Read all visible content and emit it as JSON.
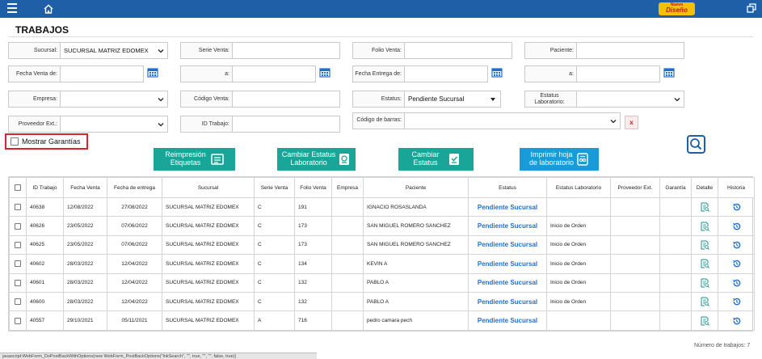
{
  "header": {
    "brand_top": "Nuevo",
    "brand_bottom": "Diseño",
    "accent": "#1f5fa8"
  },
  "page": {
    "title": "TRABAJOS"
  },
  "filters": {
    "sucursal_label": "Sucursal:",
    "sucursal_value": "SUCURSAL MATRIZ EDOMEX",
    "serie_venta_label": "Serie Venta:",
    "folio_venta_label": "Folio Venta:",
    "paciente_label": "Paciente:",
    "fecha_venta_de_label": "Fecha Venta de:",
    "a_label": "a:",
    "fecha_entrega_de_label": "Fecha Entrega de:",
    "empresa_label": "Empresa:",
    "codigo_venta_label": "Código Venta:",
    "estatus_label": "Estatus:",
    "estatus_value": "Pendiente Sucursal",
    "estatus_lab_label_1": "Estatus",
    "estatus_lab_label_2": "Laboratorio:",
    "proveedor_label": "Proveedor Ext.:",
    "id_trabajo_label": "ID Trabajo:",
    "codigo_barras_label": "Código de barras:",
    "clear_label": "x",
    "mostrar_garantias_label": "Mostrar Garantías"
  },
  "actions": {
    "reimpresion_1": "Reimpresión",
    "reimpresion_2": "Etiquetas",
    "cambiar_lab_1": "Cambiar Estatus",
    "cambiar_lab_2": "Laboratorio",
    "cambiar_estatus_1": "Cambiar",
    "cambiar_estatus_2": "Estatus",
    "imprimir_1": "Imprimir hoja",
    "imprimir_2": "de laboratorio"
  },
  "table": {
    "headers": [
      "ID Trabajo",
      "Fecha Venta",
      "Fecha de entrega",
      "Sucursal",
      "Serie Venta",
      "Folio Venta",
      "Empresa",
      "Paciente",
      "Estatus",
      "Estatus Laboratorio",
      "Proveedor Ext.",
      "Garantía",
      "Detalle",
      "Historia"
    ],
    "rows": [
      {
        "id": "40638",
        "fecha_venta": "12/08/2022",
        "fecha_entrega": "27/08/2022",
        "sucursal": "SUCURSAL MATRIZ EDOMEX",
        "serie": "C",
        "folio": "191",
        "empresa": "",
        "paciente": "IGNACIO ROSASLANDA",
        "estatus": "Pendiente Sucursal",
        "estatus_lab": "",
        "proveedor": "",
        "garantia": ""
      },
      {
        "id": "40626",
        "fecha_venta": "23/05/2022",
        "fecha_entrega": "07/06/2022",
        "sucursal": "SUCURSAL MATRIZ EDOMEX",
        "serie": "C",
        "folio": "173",
        "empresa": "",
        "paciente": "SAN MIGUEL ROMERO SANCHEZ",
        "estatus": "Pendiente Sucursal",
        "estatus_lab": "Inicio de Orden",
        "proveedor": "",
        "garantia": ""
      },
      {
        "id": "40625",
        "fecha_venta": "23/05/2022",
        "fecha_entrega": "07/06/2022",
        "sucursal": "SUCURSAL MATRIZ EDOMEX",
        "serie": "C",
        "folio": "173",
        "empresa": "",
        "paciente": "SAN MIGUEL ROMERO SANCHEZ",
        "estatus": "Pendiente Sucursal",
        "estatus_lab": "Inicio de Orden",
        "proveedor": "",
        "garantia": ""
      },
      {
        "id": "40602",
        "fecha_venta": "28/03/2022",
        "fecha_entrega": "12/04/2022",
        "sucursal": "SUCURSAL MATRIZ EDOMEX",
        "serie": "C",
        "folio": "134",
        "empresa": "",
        "paciente": "KEVIN A",
        "estatus": "Pendiente Sucursal",
        "estatus_lab": "Inicio de Orden",
        "proveedor": "",
        "garantia": ""
      },
      {
        "id": "40601",
        "fecha_venta": "28/03/2022",
        "fecha_entrega": "12/04/2022",
        "sucursal": "SUCURSAL MATRIZ EDOMEX",
        "serie": "C",
        "folio": "132",
        "empresa": "",
        "paciente": "PABLO A",
        "estatus": "Pendiente Sucursal",
        "estatus_lab": "Inicio de Orden",
        "proveedor": "",
        "garantia": ""
      },
      {
        "id": "40600",
        "fecha_venta": "28/03/2022",
        "fecha_entrega": "12/04/2022",
        "sucursal": "SUCURSAL MATRIZ EDOMEX",
        "serie": "C",
        "folio": "132",
        "empresa": "",
        "paciente": "PABLO A",
        "estatus": "Pendiente Sucursal",
        "estatus_lab": "Inicio de Orden",
        "proveedor": "",
        "garantia": ""
      },
      {
        "id": "40557",
        "fecha_venta": "29/10/2021",
        "fecha_entrega": "05/11/2021",
        "sucursal": "SUCURSAL MATRIZ EDOMEX",
        "serie": "A",
        "folio": "716",
        "empresa": "",
        "paciente": "pedro camara pech",
        "estatus": "Pendiente Sucursal",
        "estatus_lab": "",
        "proveedor": "",
        "garantia": ""
      }
    ]
  },
  "footer": {
    "count_label": "Número de trabajos: 7",
    "status_text": "javascript:WebForm_DoPostBackWithOptions(new WebForm_PostBackOptions(\"lnkSearch\", \"\", true, \"\", \"\", false, true))"
  }
}
